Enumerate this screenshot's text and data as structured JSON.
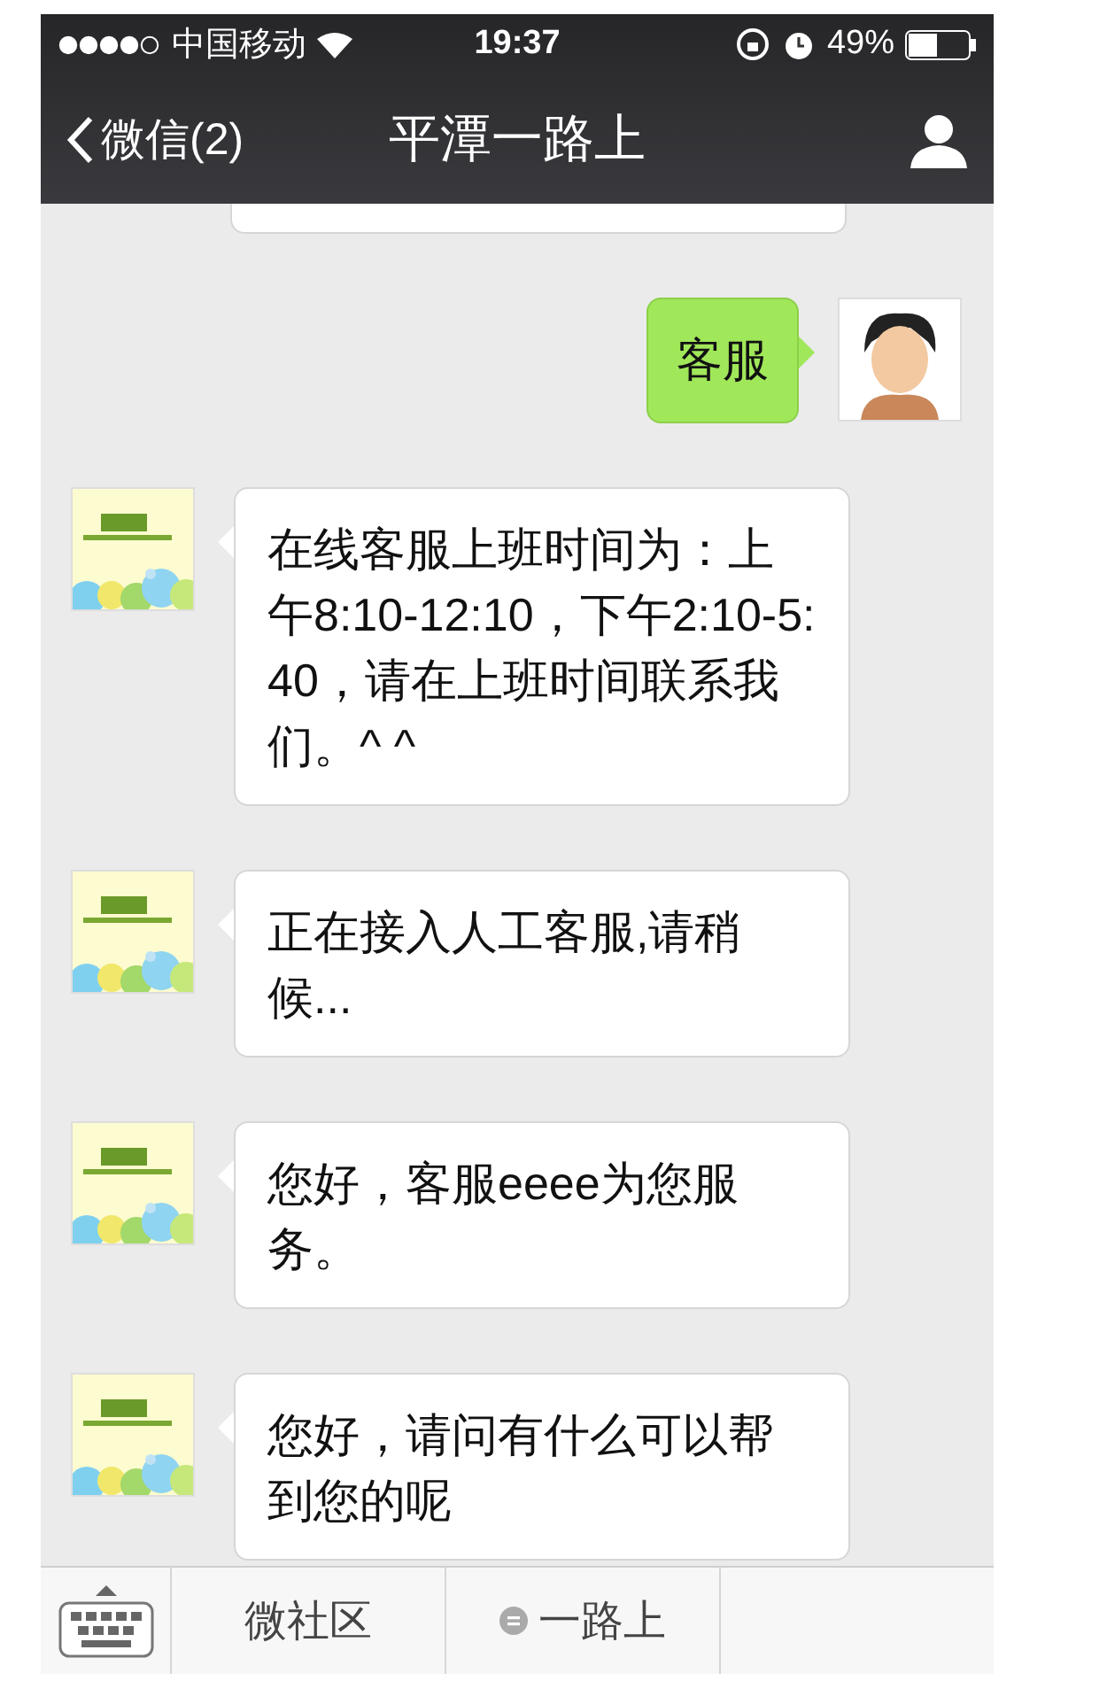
{
  "status_bar": {
    "carrier": "中国移动",
    "time": "19:37",
    "battery": "49%"
  },
  "nav": {
    "back": "微信(2)",
    "title": "平潭一路上"
  },
  "messages": [
    {
      "kind": "outgoing",
      "text": "客服"
    },
    {
      "kind": "incoming",
      "text": "在线客服上班时间为：上午8:10-12:10，下午2:10-5:40，请在上班时间联系我们。^ ^"
    },
    {
      "kind": "incoming",
      "text": "正在接入人工客服,请稍候..."
    },
    {
      "kind": "incoming",
      "text": "您好，客服eeee为您服务。"
    },
    {
      "kind": "incoming",
      "text": "您好，请问有什么可以帮到您的呢"
    }
  ],
  "menu": [
    {
      "label": "微社区",
      "submenu": false
    },
    {
      "label": "一路上",
      "submenu": true
    }
  ]
}
